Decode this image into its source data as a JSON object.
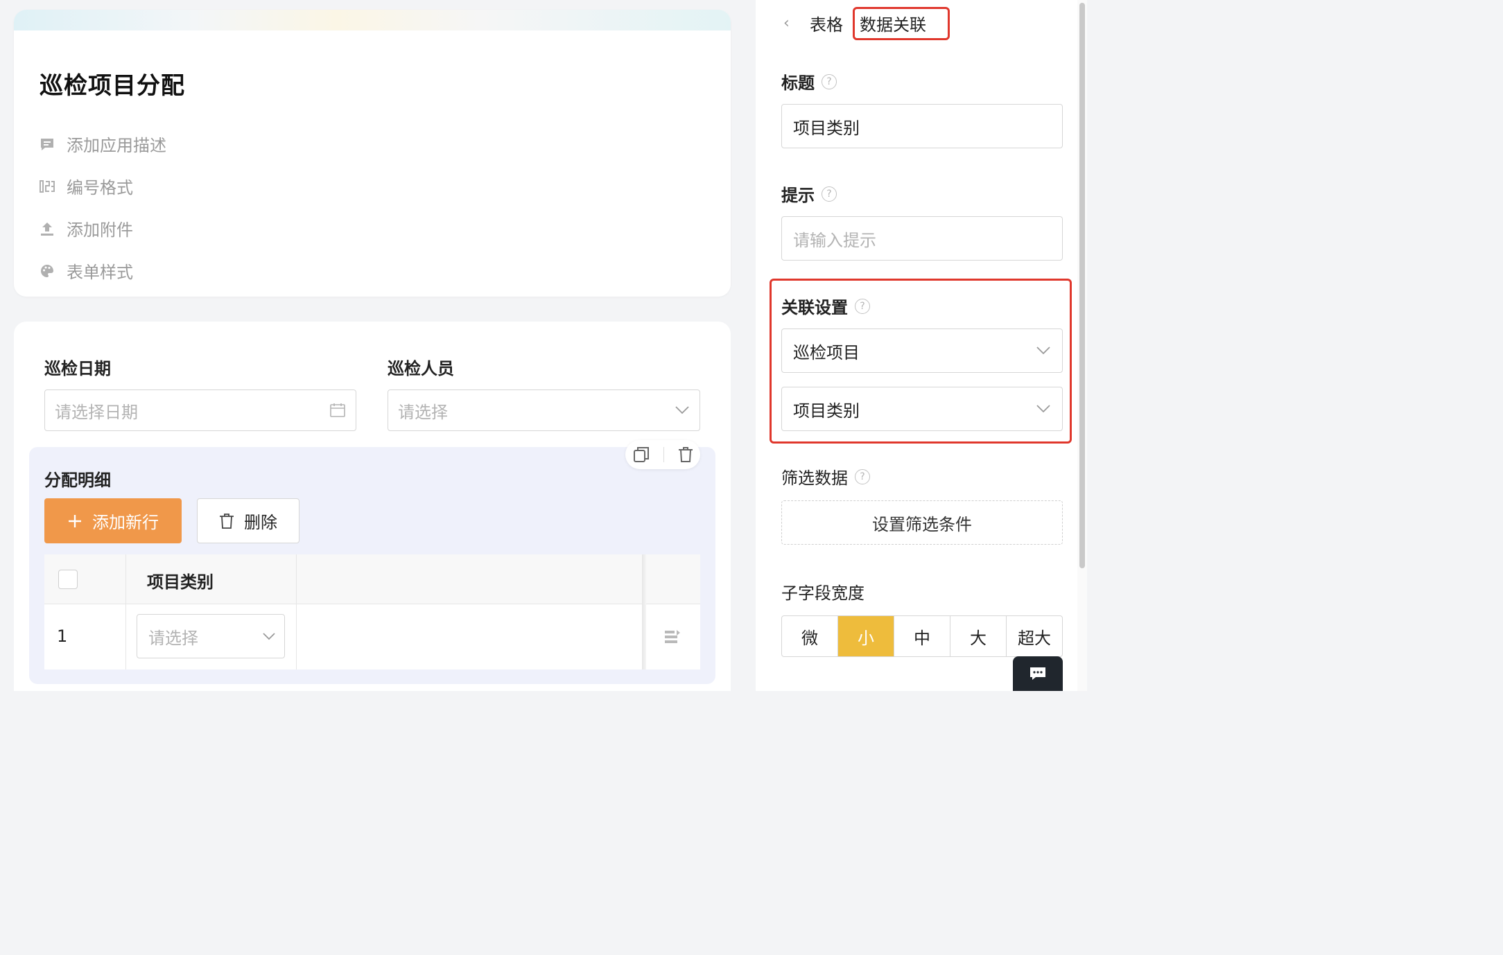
{
  "form": {
    "title": "巡检项目分配",
    "options": [
      {
        "icon": "comment-icon",
        "label": "添加应用描述"
      },
      {
        "icon": "number-format-icon",
        "label": "编号格式"
      },
      {
        "icon": "upload-icon",
        "label": "添加附件"
      },
      {
        "icon": "palette-icon",
        "label": "表单样式"
      }
    ],
    "fields": {
      "date_label": "巡检日期",
      "date_placeholder": "请选择日期",
      "person_label": "巡检人员",
      "person_placeholder": "请选择"
    },
    "subtable": {
      "title": "分配明细",
      "add_row_label": "添加新行",
      "delete_label": "删除",
      "column_header": "项目类别",
      "rows": [
        {
          "index": "1",
          "placeholder": "请选择"
        }
      ]
    }
  },
  "panel": {
    "breadcrumb": [
      "表格",
      "数据关联"
    ],
    "title_label": "标题",
    "title_value": "项目类别",
    "hint_label": "提示",
    "hint_placeholder": "请输入提示",
    "link_label": "关联设置",
    "link_form": "巡检项目",
    "link_field": "项目类别",
    "filter_label": "筛选数据",
    "filter_button": "设置筛选条件",
    "width_label": "子字段宽度",
    "width_options": [
      "微",
      "小",
      "中",
      "大",
      "超大"
    ],
    "width_selected": "小"
  },
  "colors": {
    "accent_orange": "#f0984a",
    "selected_yellow": "#eebc3c",
    "highlight_red": "#e0372c"
  }
}
